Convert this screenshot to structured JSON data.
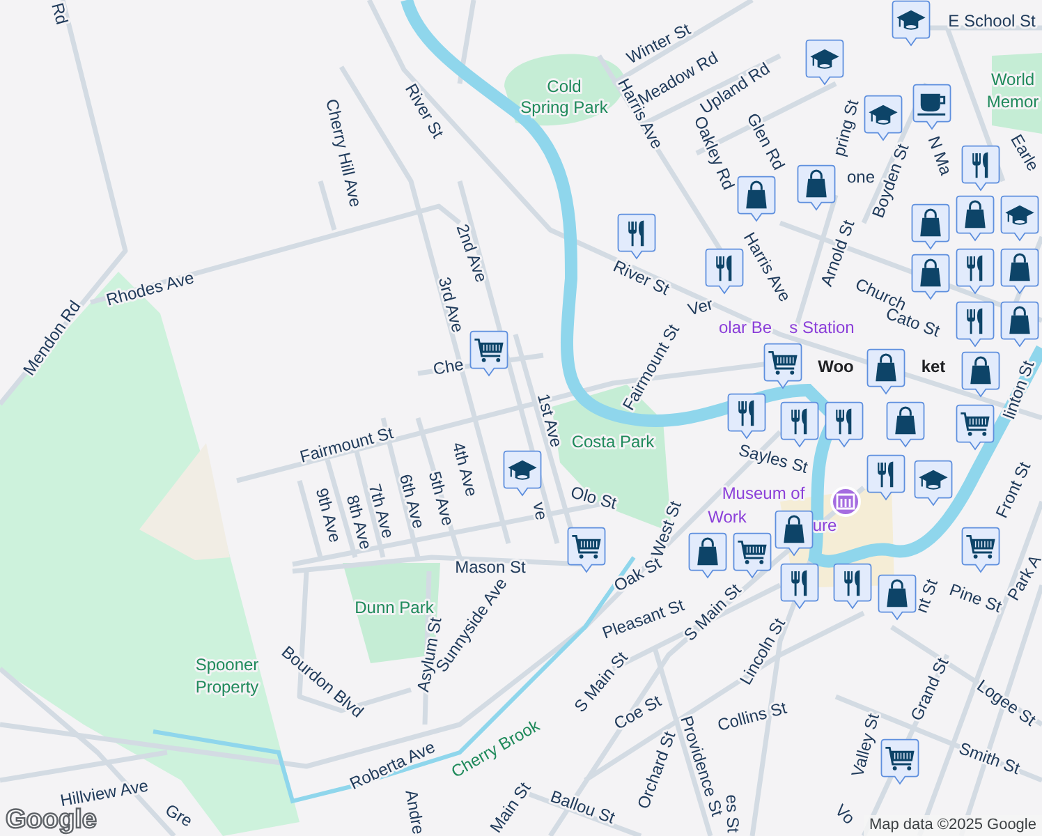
{
  "map": {
    "labels": [
      {
        "text": "Rd",
        "kind": "street"
      },
      {
        "text": "Winter St",
        "kind": "street"
      },
      {
        "text": "Meadow Rd",
        "kind": "street"
      },
      {
        "text": "Upland Rd",
        "kind": "street"
      },
      {
        "text": "Harris Ave",
        "kind": "street"
      },
      {
        "text": "Oakley Rd",
        "kind": "street"
      },
      {
        "text": "Glen Rd",
        "kind": "street"
      },
      {
        "text": "E School St",
        "kind": "street"
      },
      {
        "text": "pring St",
        "kind": "street"
      },
      {
        "text": "Boyden St",
        "kind": "street"
      },
      {
        "text": "N Ma",
        "kind": "street"
      },
      {
        "text": "Earle",
        "kind": "street"
      },
      {
        "text": "World",
        "kind": "park"
      },
      {
        "text": "Memor",
        "kind": "park"
      },
      {
        "text": "Cold",
        "kind": "park"
      },
      {
        "text": "Spring Park",
        "kind": "park"
      },
      {
        "text": "River St",
        "kind": "street"
      },
      {
        "text": "Cherry Hill Ave",
        "kind": "street"
      },
      {
        "text": "one",
        "kind": "street"
      },
      {
        "text": "Harris Ave",
        "kind": "street"
      },
      {
        "text": "Arnold St",
        "kind": "street"
      },
      {
        "text": "Church",
        "kind": "street"
      },
      {
        "text": "Cato St",
        "kind": "street"
      },
      {
        "text": "linton St",
        "kind": "street"
      },
      {
        "text": "River St",
        "kind": "street"
      },
      {
        "text": "Ver",
        "kind": "street"
      },
      {
        "text": "olar Be",
        "kind": "poi"
      },
      {
        "text": "s Station",
        "kind": "poi"
      },
      {
        "text": "Fairmount St",
        "kind": "street"
      },
      {
        "text": "Woo",
        "kind": "town"
      },
      {
        "text": "ket",
        "kind": "town"
      },
      {
        "text": "Mendon Rd",
        "kind": "street"
      },
      {
        "text": "Rhodes Ave",
        "kind": "street"
      },
      {
        "text": "2nd Ave",
        "kind": "street"
      },
      {
        "text": "3rd Ave",
        "kind": "street"
      },
      {
        "text": "Che",
        "kind": "street"
      },
      {
        "text": "1st Ave",
        "kind": "street"
      },
      {
        "text": "Fairmount St",
        "kind": "street"
      },
      {
        "text": "Costa Park",
        "kind": "park"
      },
      {
        "text": "Sayles St",
        "kind": "street"
      },
      {
        "text": "Front St",
        "kind": "street"
      },
      {
        "text": "4th Ave",
        "kind": "street"
      },
      {
        "text": "5th Ave",
        "kind": "street"
      },
      {
        "text": "6th Ave",
        "kind": "street"
      },
      {
        "text": "7th Ave",
        "kind": "street"
      },
      {
        "text": "8th Ave",
        "kind": "street"
      },
      {
        "text": "9th Ave",
        "kind": "street"
      },
      {
        "text": "ve",
        "kind": "street"
      },
      {
        "text": "Olo St",
        "kind": "street"
      },
      {
        "text": "West St",
        "kind": "street"
      },
      {
        "text": "Museum of",
        "kind": "poi"
      },
      {
        "text": "Work",
        "kind": "poi"
      },
      {
        "text": "ure",
        "kind": "poi"
      },
      {
        "text": "Mason St",
        "kind": "street"
      },
      {
        "text": "Oak St",
        "kind": "street"
      },
      {
        "text": "Pine St",
        "kind": "street"
      },
      {
        "text": "Park A",
        "kind": "street"
      },
      {
        "text": "nt St",
        "kind": "street"
      },
      {
        "text": "Dunn Park",
        "kind": "park"
      },
      {
        "text": "Pleasant St",
        "kind": "street"
      },
      {
        "text": "S Main St",
        "kind": "street"
      },
      {
        "text": "Lincoln St",
        "kind": "street"
      },
      {
        "text": "Sunnyside Ave",
        "kind": "street"
      },
      {
        "text": "Asylum St",
        "kind": "street"
      },
      {
        "text": "Spooner",
        "kind": "park"
      },
      {
        "text": "Property",
        "kind": "park"
      },
      {
        "text": "Bourdon Blvd",
        "kind": "street"
      },
      {
        "text": "Grand St",
        "kind": "street"
      },
      {
        "text": "Logee St",
        "kind": "street"
      },
      {
        "text": "S Main St",
        "kind": "street"
      },
      {
        "text": "Coe St",
        "kind": "street"
      },
      {
        "text": "Collins St",
        "kind": "street"
      },
      {
        "text": "Valley St",
        "kind": "street"
      },
      {
        "text": "Smith St",
        "kind": "street"
      },
      {
        "text": "Orchard St",
        "kind": "street"
      },
      {
        "text": "Providence St",
        "kind": "street"
      },
      {
        "text": "Roberta Ave",
        "kind": "street"
      },
      {
        "text": "Cherry Brook",
        "kind": "water"
      },
      {
        "text": "Hillview Ave",
        "kind": "street"
      },
      {
        "text": "Andre",
        "kind": "street"
      },
      {
        "text": "Ballou St",
        "kind": "street"
      },
      {
        "text": "Main St",
        "kind": "street"
      },
      {
        "text": "es St",
        "kind": "street"
      },
      {
        "text": "Gre",
        "kind": "street"
      },
      {
        "text": "Vo",
        "kind": "street"
      }
    ],
    "markers": [
      {
        "kind": "school"
      },
      {
        "kind": "school"
      },
      {
        "kind": "school"
      },
      {
        "kind": "restaurant"
      },
      {
        "kind": "cafe"
      },
      {
        "kind": "shopping"
      },
      {
        "kind": "shopping"
      },
      {
        "kind": "school"
      },
      {
        "kind": "shopping"
      },
      {
        "kind": "shopping"
      },
      {
        "kind": "restaurant"
      },
      {
        "kind": "shopping"
      },
      {
        "kind": "shopping"
      },
      {
        "kind": "restaurant"
      },
      {
        "kind": "restaurant"
      },
      {
        "kind": "restaurant"
      },
      {
        "kind": "shopping"
      },
      {
        "kind": "grocery"
      },
      {
        "kind": "shopping"
      },
      {
        "kind": "grocery"
      },
      {
        "kind": "shopping"
      },
      {
        "kind": "grocery"
      },
      {
        "kind": "restaurant"
      },
      {
        "kind": "restaurant"
      },
      {
        "kind": "restaurant"
      },
      {
        "kind": "restaurant"
      },
      {
        "kind": "shopping"
      },
      {
        "kind": "school"
      },
      {
        "kind": "school"
      },
      {
        "kind": "grocery"
      },
      {
        "kind": "shopping"
      },
      {
        "kind": "grocery"
      },
      {
        "kind": "shopping"
      },
      {
        "kind": "restaurant"
      },
      {
        "kind": "grocery"
      },
      {
        "kind": "restaurant"
      },
      {
        "kind": "shopping"
      },
      {
        "kind": "grocery"
      }
    ],
    "logo": "Google",
    "attribution": "Map data ©2025 Google"
  }
}
